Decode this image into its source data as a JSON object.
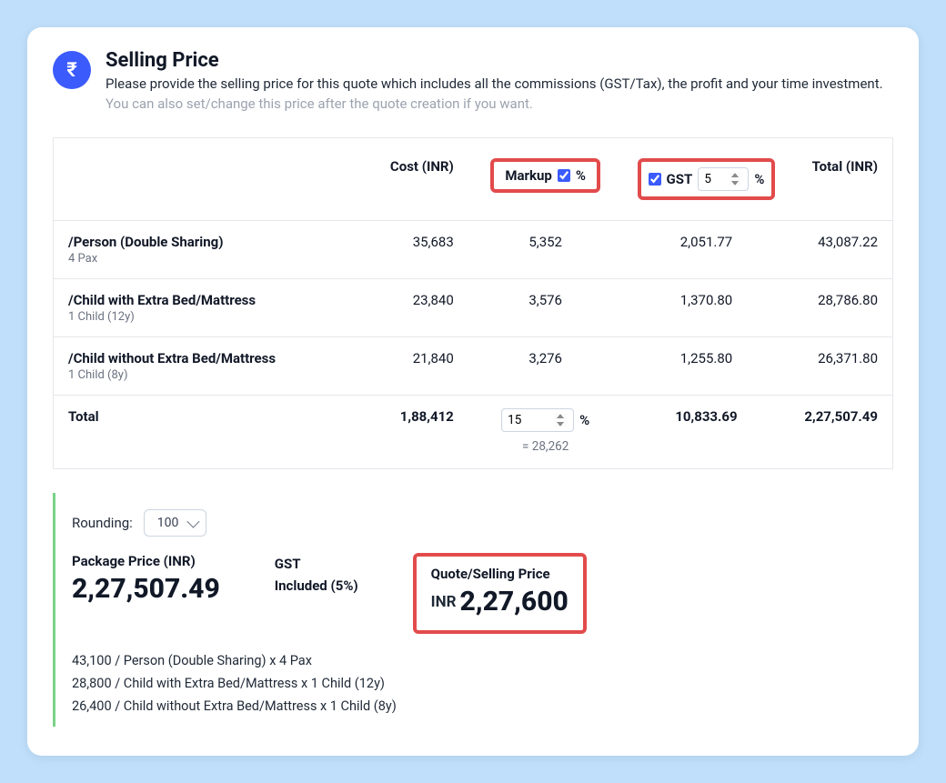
{
  "header": {
    "title": "Selling Price",
    "desc": "Please provide the selling price for this quote which includes all the commissions (GST/Tax), the profit and your time investment.",
    "hint": "You can also set/change this price after the quote creation if you want."
  },
  "columns": {
    "name": "",
    "cost": "Cost (INR)",
    "markup": "Markup",
    "gst": "GST",
    "total": "Total (INR)"
  },
  "gst_header_value": "5",
  "pct_sign": "%",
  "rows": [
    {
      "name": "/Person (Double Sharing)",
      "sub": "4 Pax",
      "cost": "35,683",
      "markup": "5,352",
      "gst": "2,051.77",
      "total": "43,087.22"
    },
    {
      "name": "/Child with Extra Bed/Mattress",
      "sub": "1 Child (12y)",
      "cost": "23,840",
      "markup": "3,576",
      "gst": "1,370.80",
      "total": "28,786.80"
    },
    {
      "name": "/Child without Extra Bed/Mattress",
      "sub": "1 Child (8y)",
      "cost": "21,840",
      "markup": "3,276",
      "gst": "1,255.80",
      "total": "26,371.80"
    }
  ],
  "totals": {
    "label": "Total",
    "cost": "1,88,412",
    "markup_input": "15",
    "markup_eq": "= 28,262",
    "gst": "10,833.69",
    "total": "2,27,507.49"
  },
  "summary": {
    "rounding_label": "Rounding:",
    "rounding_value": "100",
    "package_label": "Package Price (INR)",
    "package_value": "2,27,507.49",
    "gst_line1": "GST",
    "gst_line2": "Included (5%)",
    "quote_label": "Quote/Selling Price",
    "quote_currency": "INR",
    "quote_value": "2,27,600"
  },
  "breakdown": [
    "43,100  / Person (Double Sharing) x 4 Pax",
    "28,800  / Child with Extra Bed/Mattress x 1 Child (12y)",
    "26,400  / Child without Extra Bed/Mattress x 1 Child (8y)"
  ]
}
